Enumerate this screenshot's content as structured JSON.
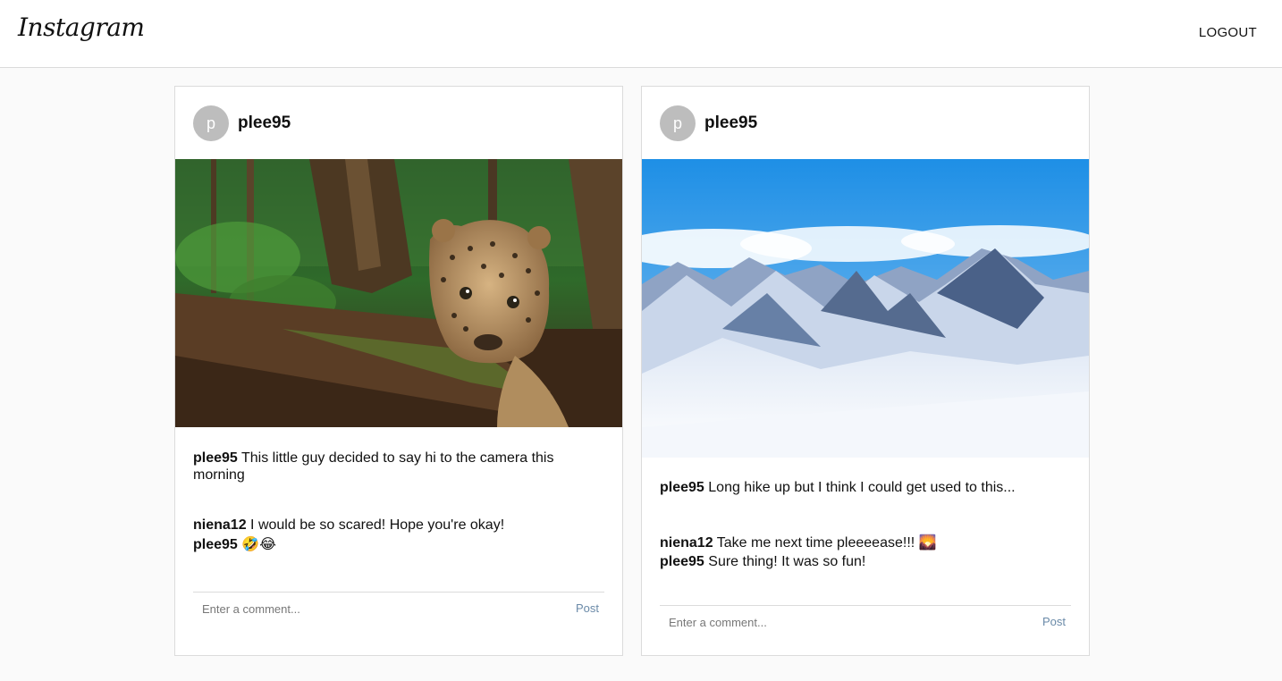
{
  "header": {
    "logo": "Instagram",
    "logout_label": "LOGOUT"
  },
  "posts": [
    {
      "username": "plee95",
      "avatar_initial": "p",
      "image": "jaguar-in-jungle",
      "caption_user": "plee95",
      "caption_text": "This little guy decided to say hi to the camera this morning",
      "comments": [
        {
          "user": "niena12",
          "text": "I would be so scared! Hope you're okay!"
        },
        {
          "user": "plee95",
          "text": "🤣😂"
        }
      ],
      "comment_placeholder": "Enter a comment...",
      "post_label": "Post"
    },
    {
      "username": "plee95",
      "avatar_initial": "p",
      "image": "snowy-mountains",
      "caption_user": "plee95",
      "caption_text": "Long hike up but I think I could get used to this...",
      "comments": [
        {
          "user": "niena12",
          "text": "Take me next time pleeeease!!! 🌄"
        },
        {
          "user": "plee95",
          "text": "Sure thing! It was so fun!"
        }
      ],
      "comment_placeholder": "Enter a comment...",
      "post_label": "Post"
    }
  ],
  "colors": {
    "background": "#fafafa",
    "border": "#dbdbdb",
    "avatar": "#bdbdbd",
    "post_link": "#6a8aa8"
  }
}
